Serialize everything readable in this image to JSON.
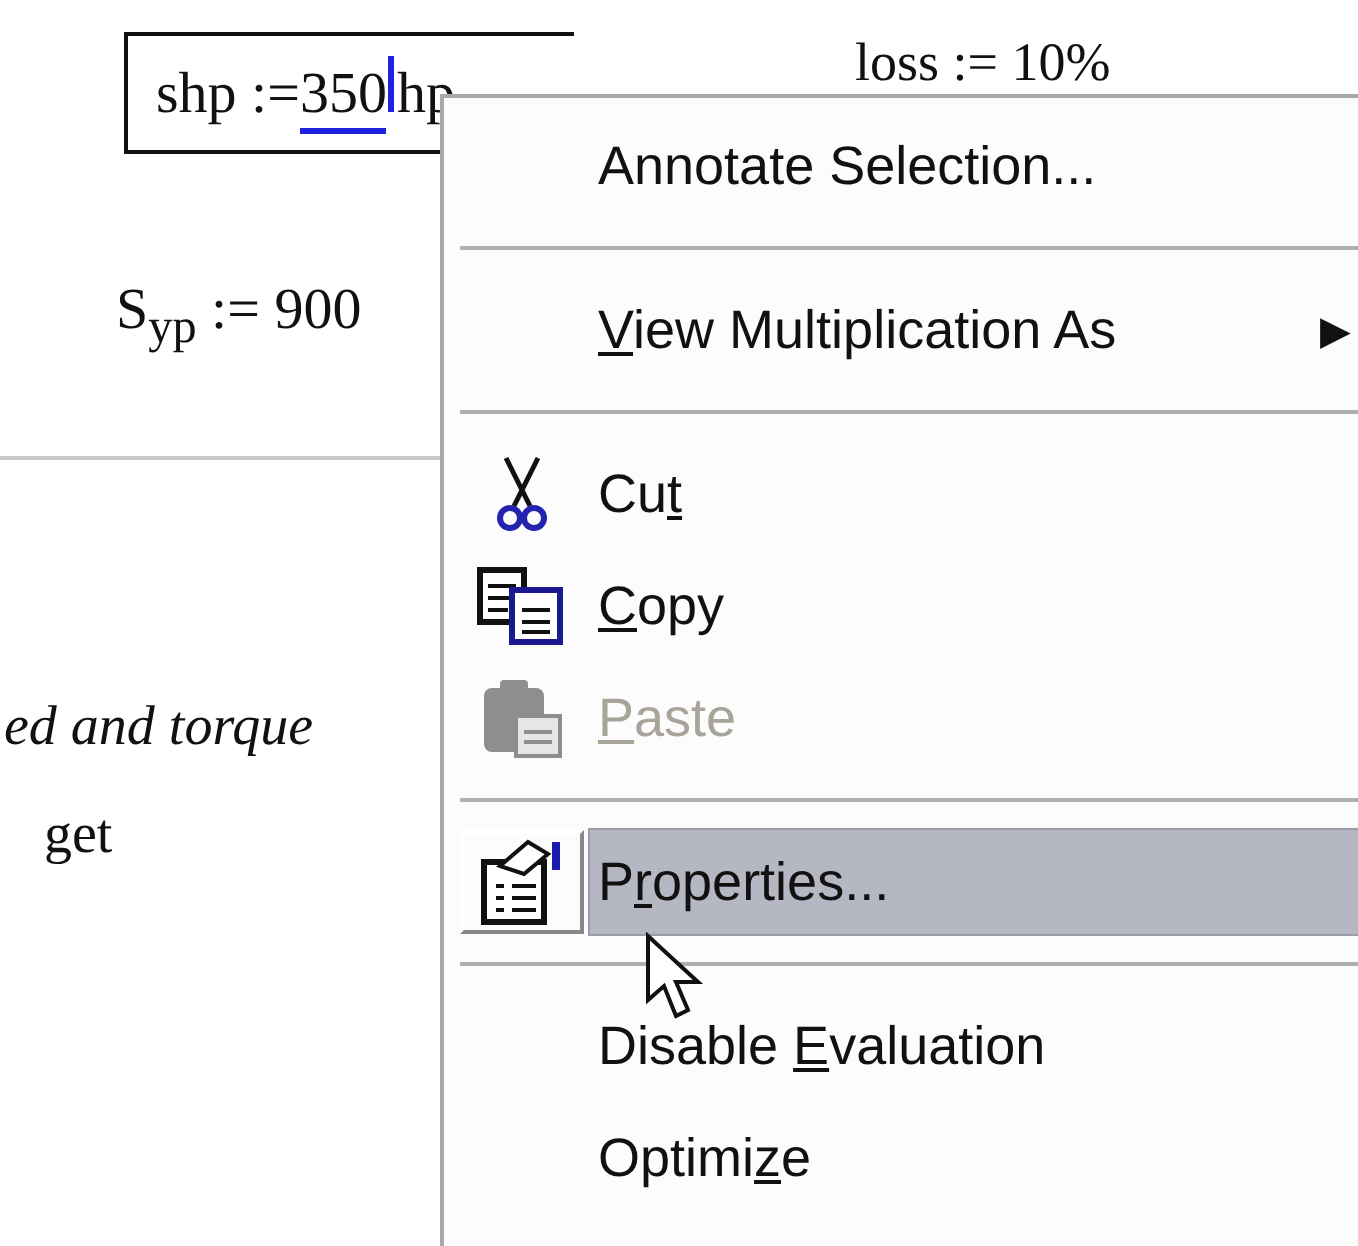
{
  "document": {
    "selected_expression": {
      "name": "shp := ",
      "value": "350",
      "unit": "hp"
    },
    "other_expressions": [
      "loss := 10%"
    ],
    "syp": {
      "base": "S",
      "sub": "yp",
      "rest": " := 900"
    },
    "text_lines": [
      "ed and torque",
      "get"
    ]
  },
  "context_menu": [
    {
      "kind": "plain",
      "label": {
        "before": "Annotate Selection..."
      },
      "disabled": false,
      "selected": false
    },
    {
      "kind": "separator"
    },
    {
      "kind": "submenu",
      "label": {
        "key": "V",
        "after": "iew Multiplication As"
      },
      "arrow": "▶",
      "disabled": false,
      "selected": false
    },
    {
      "kind": "separator"
    },
    {
      "kind": "scissors",
      "label": {
        "before": "Cu",
        "key": "t"
      },
      "disabled": false,
      "selected": false
    },
    {
      "kind": "copy",
      "label": {
        "key": "C",
        "after": "opy"
      },
      "disabled": false,
      "selected": false
    },
    {
      "kind": "paste",
      "label": {
        "key": "P",
        "after": "aste"
      },
      "disabled": true,
      "selected": false
    },
    {
      "kind": "separator"
    },
    {
      "kind": "properties",
      "label": {
        "before": "P",
        "key": "r",
        "after": "operties..."
      },
      "disabled": false,
      "selected": true
    },
    {
      "kind": "separator"
    },
    {
      "kind": "plain",
      "label": {
        "before": "Disable ",
        "key": "E",
        "after": "valuation"
      },
      "disabled": false,
      "selected": false
    },
    {
      "kind": "plain",
      "label": {
        "before": "Optimi",
        "key": "z",
        "after": "e"
      },
      "disabled": false,
      "selected": false
    }
  ]
}
